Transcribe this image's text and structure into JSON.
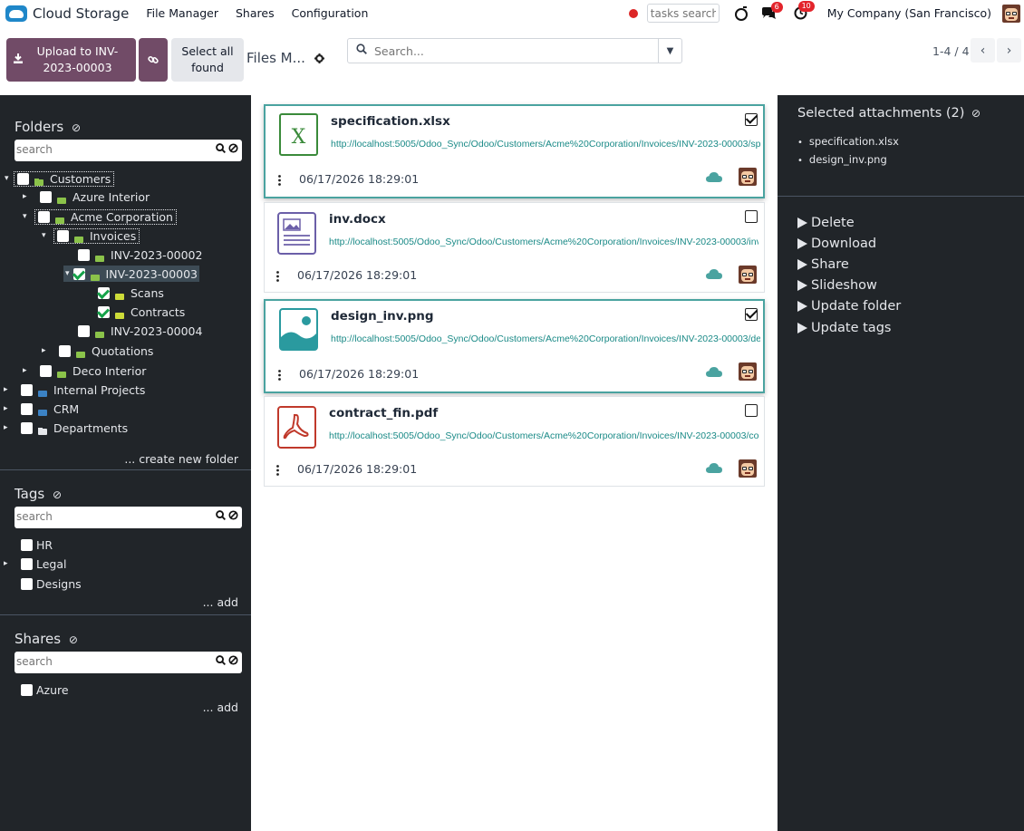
{
  "topbar": {
    "app_name": "Cloud Storage",
    "menu": [
      "File Manager",
      "Shares",
      "Configuration"
    ],
    "tasks_search_placeholder": "tasks search",
    "messages_badge": "6",
    "activities_badge": "10",
    "company": "My Company (San Francisco)"
  },
  "controls": {
    "upload_label": "Upload to INV-2023-00003",
    "select_all_label": "Select all found",
    "files_title": "Files M...",
    "search_placeholder": "Search...",
    "pager": "1-4 / 4"
  },
  "folders": {
    "heading": "Folders",
    "search_placeholder": "search",
    "tree": [
      {
        "label": "Customers",
        "checked": false
      },
      {
        "label": "Azure Interior",
        "checked": false
      },
      {
        "label": "Acme Corporation",
        "checked": false
      },
      {
        "label": "Invoices",
        "checked": false
      },
      {
        "label": "INV-2023-00002",
        "checked": false
      },
      {
        "label": "INV-2023-00003",
        "checked": true
      },
      {
        "label": "Scans",
        "checked": true
      },
      {
        "label": "Contracts",
        "checked": true
      },
      {
        "label": "INV-2023-00004",
        "checked": false
      },
      {
        "label": "Quotations",
        "checked": false
      },
      {
        "label": "Deco Interior",
        "checked": false
      },
      {
        "label": "Internal Projects",
        "checked": false
      },
      {
        "label": "CRM",
        "checked": false
      },
      {
        "label": "Departments",
        "checked": false
      }
    ],
    "create_link": "... create new folder"
  },
  "tags": {
    "heading": "Tags",
    "search_placeholder": "search",
    "items": [
      "HR",
      "Legal",
      "Designs"
    ],
    "add_link": "... add"
  },
  "shares": {
    "heading": "Shares",
    "search_placeholder": "search",
    "items": [
      "Azure"
    ],
    "add_link": "... add"
  },
  "files": [
    {
      "name": "specification.xlsx",
      "url": "http://localhost:5005/Odoo_Sync/Odoo/Customers/Acme%20Corporation/Invoices/INV-2023-00003/specification.xlsx",
      "date": "06/17/2026 18:29:01",
      "selected": true,
      "icon": "excel-icon"
    },
    {
      "name": "inv.docx",
      "url": "http://localhost:5005/Odoo_Sync/Odoo/Customers/Acme%20Corporation/Invoices/INV-2023-00003/inv.docx",
      "date": "06/17/2026 18:29:01",
      "selected": false,
      "icon": "document-icon"
    },
    {
      "name": "design_inv.png",
      "url": "http://localhost:5005/Odoo_Sync/Odoo/Customers/Acme%20Corporation/Invoices/INV-2023-00003/design_inv.png",
      "date": "06/17/2026 18:29:01",
      "selected": true,
      "icon": "image-icon"
    },
    {
      "name": "contract_fin.pdf",
      "url": "http://localhost:5005/Odoo_Sync/Odoo/Customers/Acme%20Corporation/Invoices/INV-2023-00003/contract_fin.pdf",
      "date": "06/17/2026 18:29:01",
      "selected": false,
      "icon": "pdf-icon"
    }
  ],
  "selection": {
    "title": "Selected attachments (2)",
    "items": [
      "specification.xlsx",
      "design_inv.png"
    ],
    "actions": [
      "Delete",
      "Download",
      "Share",
      "Slideshow",
      "Update folder",
      "Update tags"
    ]
  },
  "colors": {
    "brand": "#714b67",
    "panel": "#212529",
    "accent": "#4aa3a0",
    "url": "#1a8a87"
  }
}
